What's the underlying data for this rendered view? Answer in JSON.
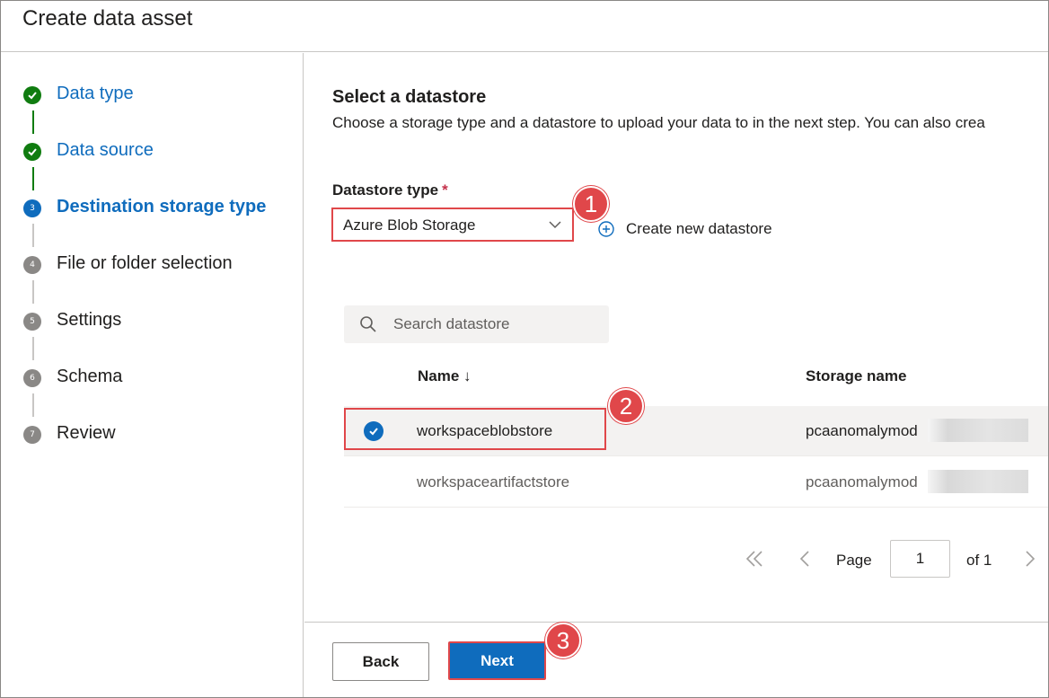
{
  "header": {
    "title": "Create data asset"
  },
  "steps": [
    {
      "num": "",
      "label": "Data type",
      "state": "done"
    },
    {
      "num": "",
      "label": "Data source",
      "state": "done"
    },
    {
      "num": "3",
      "label": "Destination storage type",
      "state": "current"
    },
    {
      "num": "4",
      "label": "File or folder selection",
      "state": "todo"
    },
    {
      "num": "5",
      "label": "Settings",
      "state": "todo"
    },
    {
      "num": "6",
      "label": "Schema",
      "state": "todo"
    },
    {
      "num": "7",
      "label": "Review",
      "state": "todo"
    }
  ],
  "main": {
    "section_title": "Select a datastore",
    "section_desc": "Choose a storage type and a datastore to upload your data to in the next step. You can also crea",
    "datastore_type_label": "Datastore type",
    "required_mark": "*",
    "datastore_type_value": "Azure Blob Storage",
    "create_new_label": "Create new datastore",
    "search_placeholder": "Search datastore",
    "table": {
      "col_name": "Name ↓",
      "col_storage": "Storage name",
      "rows": [
        {
          "name": "workspaceblobstore",
          "storage": "pcaanomalymod",
          "selected": true
        },
        {
          "name": "workspaceartifactstore",
          "storage": "pcaanomalymod",
          "selected": false
        }
      ]
    },
    "pager": {
      "page_label": "Page",
      "page_value": "1",
      "of_label": "of 1"
    }
  },
  "footer": {
    "back_label": "Back",
    "next_label": "Next"
  },
  "annotations": {
    "badge1": "1",
    "badge2": "2",
    "badge3": "3"
  },
  "colors": {
    "accent": "#0f6cbd",
    "done": "#107c10",
    "highlight": "#e0474a"
  }
}
